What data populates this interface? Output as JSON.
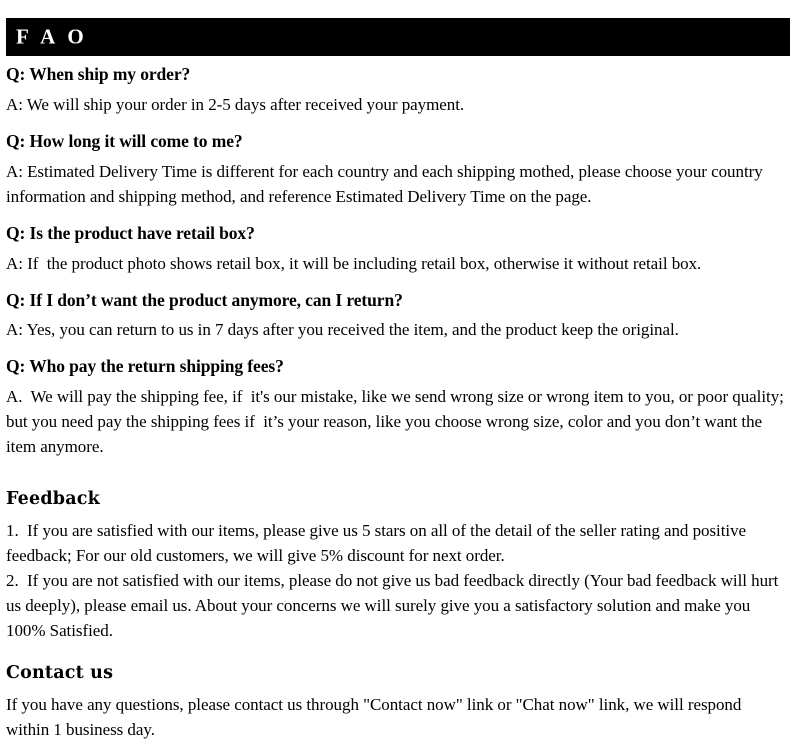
{
  "banner": {
    "title": "F A O",
    "background_color": "#000000",
    "text_color": "#ffffff"
  },
  "faq": {
    "items": [
      {
        "question": "Q: When ship my order?",
        "answer": "A: We will ship your order in 2-5 days after received your payment."
      },
      {
        "question": "Q: How long it will come to me?",
        "answer": "A: Estimated Delivery Time is different for each country and each shipping mothed, please choose your country information and shipping method, and reference Estimated Delivery Time on the page."
      },
      {
        "question": "Q: Is the product have retail box?",
        "answer": "A: If  the product photo shows retail box, it will be including retail box, otherwise it without retail box."
      },
      {
        "question": "Q: If I don’t want the product anymore, can I return?",
        "answer": "A: Yes, you can return to us in 7 days after you received the item, and the product keep the original."
      },
      {
        "question": "Q: Who pay the return shipping fees?",
        "answer": "A.  We will pay the shipping fee, if  it's our mistake, like we send wrong size or wrong item to you, or poor quality; but you need pay the shipping fees if  it’s your reason, like you choose wrong size, color and you don’t want the item anymore."
      }
    ]
  },
  "feedback": {
    "heading": "Feedback",
    "paragraphs": [
      "1.  If you are satisfied with our items, please give us 5 stars on all of the detail of the seller rating and positive feedback; For our old customers, we will give 5% discount for next order.",
      "2.  If you are not satisfied with our items, please do not give us bad feedback directly (Your bad feedback will hurt us deeply), please email us. About your concerns we will surely give you a satisfactory solution and make you 100% Satisfied."
    ]
  },
  "contact": {
    "heading": "Contact us",
    "paragraphs": [
      "If you have any questions, please contact us through \"Contact now\" link or \"Chat now\" link, we will respond within 1 business day."
    ]
  }
}
